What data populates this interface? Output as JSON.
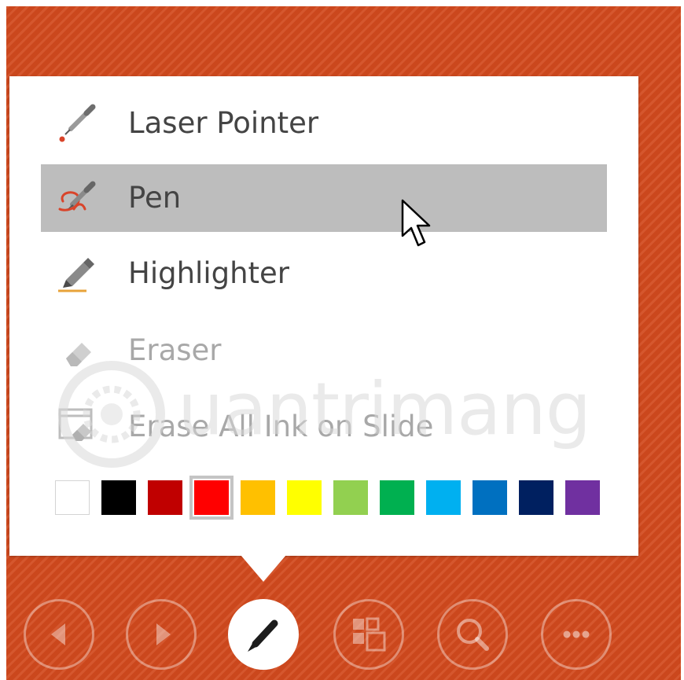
{
  "menu": {
    "items": [
      {
        "label": "Laser Pointer",
        "icon": "laser-pointer-icon",
        "state": "normal"
      },
      {
        "label": "Pen",
        "icon": "pen-icon",
        "state": "hovered"
      },
      {
        "label": "Highlighter",
        "icon": "highlighter-icon",
        "state": "normal"
      },
      {
        "label": "Eraser",
        "icon": "eraser-icon",
        "state": "disabled"
      },
      {
        "label": "Erase All Ink on Slide",
        "icon": "erase-all-ink-icon",
        "state": "disabled"
      }
    ]
  },
  "ink_colors": {
    "selected": "#ff0000",
    "swatches": [
      "#ffffff",
      "#000000",
      "#c00000",
      "#ff0000",
      "#ffc000",
      "#ffff00",
      "#92d050",
      "#00b050",
      "#00b0f0",
      "#0070c0",
      "#002060",
      "#7030a0"
    ]
  },
  "toolbar": {
    "buttons": [
      {
        "icon": "previous-icon",
        "active": false
      },
      {
        "icon": "next-icon",
        "active": false
      },
      {
        "icon": "pen-tools-icon",
        "active": true
      },
      {
        "icon": "see-all-slides-icon",
        "active": false
      },
      {
        "icon": "zoom-icon",
        "active": false
      },
      {
        "icon": "more-options-icon",
        "active": false
      }
    ]
  },
  "watermark": {
    "text": "uantrimang",
    "icon": "watermark-logo"
  },
  "theme": {
    "slide_background": "#d24a1e",
    "menu_background": "#ffffff",
    "hover_background": "#bdbdbd",
    "accent_red": "#d9442a"
  }
}
